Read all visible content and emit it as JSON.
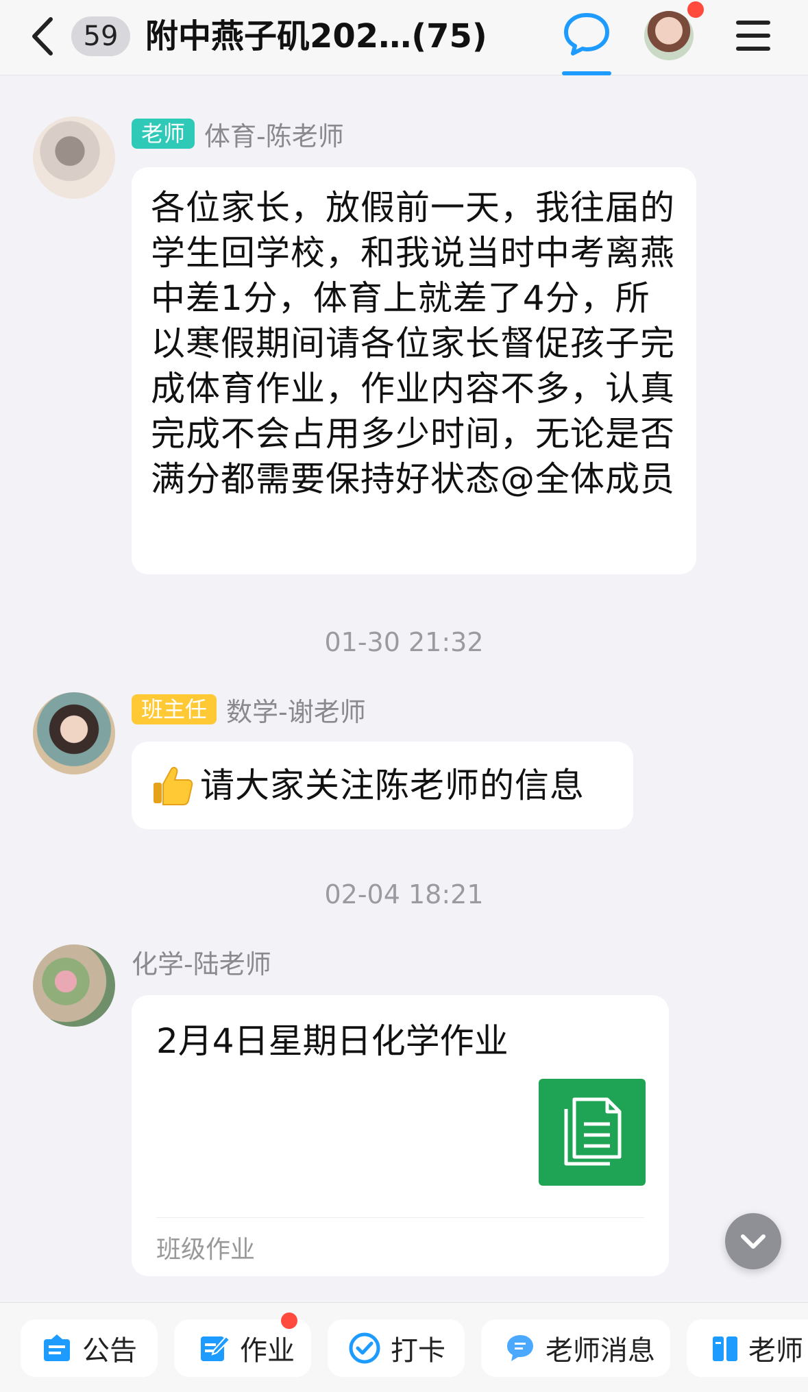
{
  "header": {
    "unread_count": "59",
    "group_title": "附中燕子矶202…(75)"
  },
  "messages": [
    {
      "role_tag": "老师",
      "sender": "体育-陈老师",
      "text": "各位家长，放假前一天，我往届的学生回学校，和我说当时中考离燕中差1分，体育上就差了4分，所以寒假期间请各位家长督促孩子完成体育作业，作业内容不多，认真完成不会占用多少时间，无论是否满分都需要保持好状态@全体成员"
    },
    {
      "timestamp": "01-30 21:32",
      "role_tag": "班主任",
      "sender": "数学-谢老师",
      "text": "请大家关注陈老师的信息"
    },
    {
      "timestamp": "02-04 18:21",
      "sender": "化学-陆老师",
      "homework_title": "2月4日星期日化学作业",
      "card_footer": "班级作业"
    }
  ],
  "toolbar": [
    {
      "label": "公告",
      "icon": "notice-icon"
    },
    {
      "label": "作业",
      "icon": "homework-icon"
    },
    {
      "label": "打卡",
      "icon": "checkin-icon"
    },
    {
      "label": "老师消息",
      "icon": "teacher-message-icon"
    },
    {
      "label": "老师",
      "icon": "teacher-icon"
    }
  ],
  "colors": {
    "accent_blue": "#1e9bff",
    "teacher_tag": "#2fc9b7",
    "head_teacher_tag": "#ffc935",
    "doc_green": "#1fa355",
    "badge_red": "#ff4a3d"
  }
}
